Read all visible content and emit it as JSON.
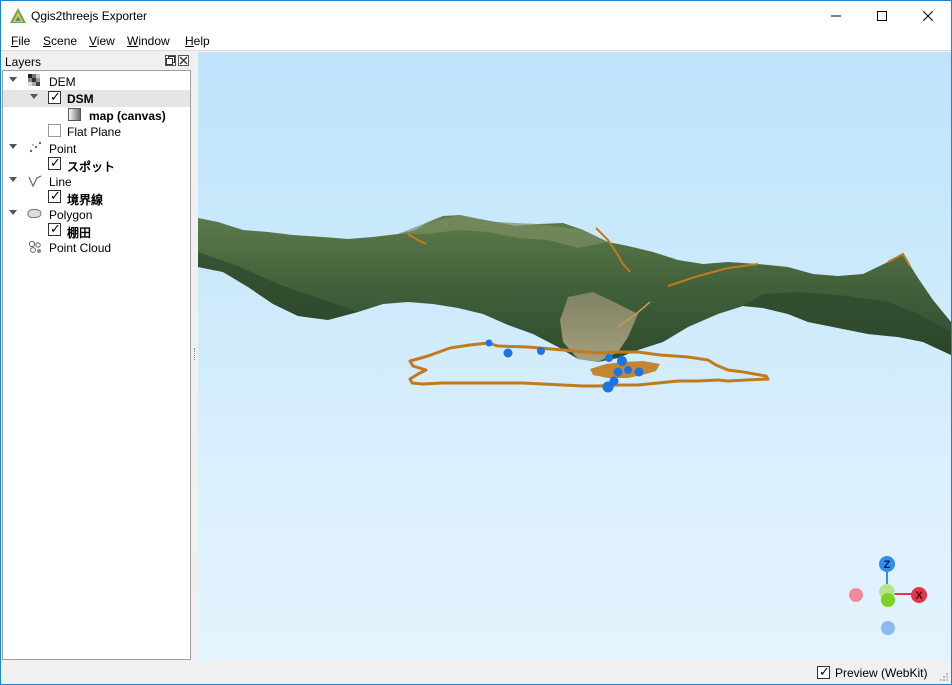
{
  "window": {
    "title": "Qgis2threejs Exporter"
  },
  "menu": {
    "items": [
      {
        "label": "File",
        "mnemonic": "F",
        "rest": "ile"
      },
      {
        "label": "Scene",
        "mnemonic": "S",
        "rest": "cene"
      },
      {
        "label": "View",
        "mnemonic": "V",
        "rest": "iew"
      },
      {
        "label": "Window",
        "mnemonic": "W",
        "rest": "indow"
      },
      {
        "label": "Help",
        "mnemonic": "H",
        "rest": "elp"
      }
    ]
  },
  "layers_panel": {
    "title": "Layers",
    "tree": [
      {
        "label": "DEM",
        "type": "group",
        "expanded": true,
        "icon": "dem-icon"
      },
      {
        "label": "DSM",
        "type": "layer",
        "checked": true,
        "expanded": true,
        "selected": true
      },
      {
        "label": "map (canvas)",
        "type": "material",
        "icon": "map-canvas-icon"
      },
      {
        "label": "Flat Plane",
        "type": "layer",
        "checked": false
      },
      {
        "label": "Point",
        "type": "group",
        "expanded": true,
        "icon": "point-icon"
      },
      {
        "label": "スポット",
        "type": "layer",
        "checked": true
      },
      {
        "label": "Line",
        "type": "group",
        "expanded": true,
        "icon": "line-icon"
      },
      {
        "label": "境界線",
        "type": "layer",
        "checked": true
      },
      {
        "label": "Polygon",
        "type": "group",
        "expanded": true,
        "icon": "polygon-icon"
      },
      {
        "label": "棚田",
        "type": "layer",
        "checked": true
      },
      {
        "label": "Point Cloud",
        "type": "group",
        "expanded": false,
        "icon": "point-cloud-icon"
      }
    ]
  },
  "viewport": {
    "axes_gizmo": {
      "z_label": "Z",
      "x_label": "X"
    }
  },
  "statusbar": {
    "preview_label": "Preview (WebKit)",
    "preview_checked": true
  },
  "colors": {
    "accent": "#1883d7",
    "boundary_line": "#c17a1d",
    "spot_points": "#1b74e4",
    "axis_x": "#e8344a",
    "axis_y": "#7ed321",
    "axis_z": "#2f8ff0"
  }
}
